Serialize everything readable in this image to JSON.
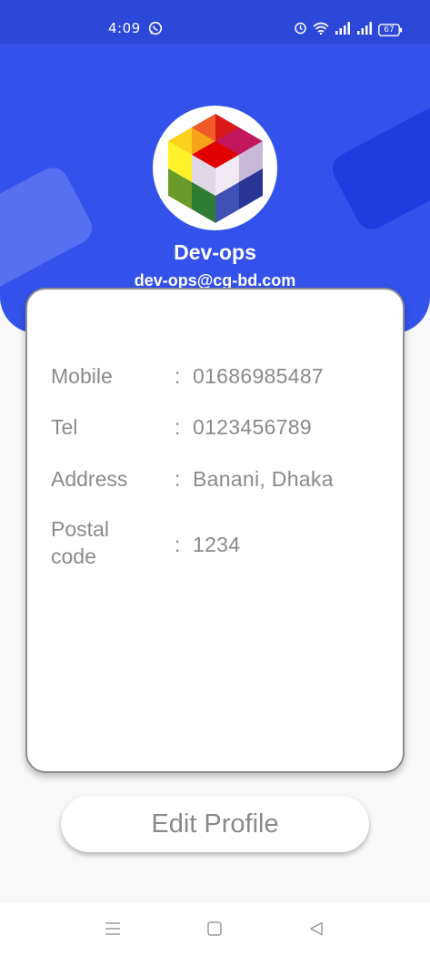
{
  "status_bar": {
    "time": "4:09",
    "battery": "67",
    "icons": [
      "whatsapp-icon",
      "alarm-icon",
      "wifi-icon",
      "signal-icon",
      "signal-icon",
      "battery-icon"
    ]
  },
  "profile": {
    "name": "Dev-ops",
    "email": "dev-ops@cg-bd.com",
    "avatar_icon": "hexagon-cube-logo"
  },
  "info": [
    {
      "label": "Mobile",
      "value": "01686985487"
    },
    {
      "label": "Tel",
      "value": "0123456789"
    },
    {
      "label": "Address",
      "value": "Banani, Dhaka"
    },
    {
      "label": "Postal code",
      "value": "1234"
    }
  ],
  "separator": ":",
  "actions": {
    "edit_label": "Edit Profile"
  },
  "nav": [
    "menu-icon",
    "home-square-icon",
    "back-triangle-icon"
  ],
  "colors": {
    "header": "#3352ec",
    "status_bar": "#2c48d8",
    "text_gray": "#8a8a8a",
    "background": "#f8f8f8"
  }
}
